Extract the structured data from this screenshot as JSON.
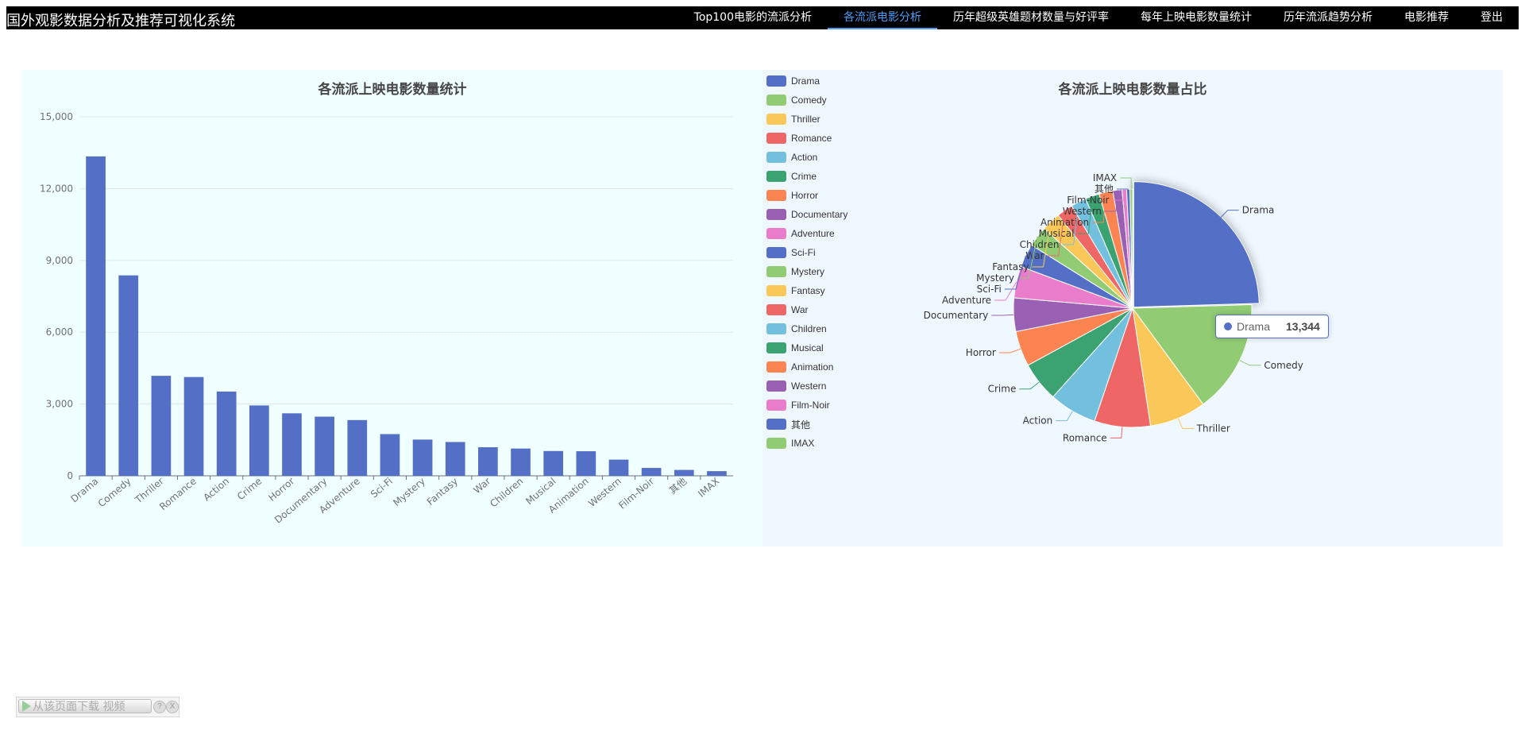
{
  "app": {
    "title": "国外观影数据分析及推荐可视化系统",
    "nav": [
      {
        "label": "Top100电影的流派分析",
        "active": false
      },
      {
        "label": "各流派电影分析",
        "active": true
      },
      {
        "label": "历年超级英雄题材数量与好评率",
        "active": false
      },
      {
        "label": "每年上映电影数量统计",
        "active": false
      },
      {
        "label": "历年流派趋势分析",
        "active": false
      },
      {
        "label": "电影推荐",
        "active": false
      },
      {
        "label": "登出",
        "active": false
      }
    ]
  },
  "chart_data": [
    {
      "type": "bar",
      "title": "各流派上映电影数量统计",
      "categories": [
        "Drama",
        "Comedy",
        "Thriller",
        "Romance",
        "Action",
        "Crime",
        "Horror",
        "Documentary",
        "Adventure",
        "Sci-Fi",
        "Mystery",
        "Fantasy",
        "War",
        "Children",
        "Musical",
        "Animation",
        "Western",
        "Film-Noir",
        "其他",
        "IMAX"
      ],
      "values": [
        13344,
        8374,
        4178,
        4127,
        3520,
        2939,
        2611,
        2471,
        2329,
        1743,
        1514,
        1412,
        1194,
        1139,
        1036,
        1027,
        676,
        330,
        246,
        196
      ],
      "yticks": [
        "0",
        "3,000",
        "6,000",
        "9,000",
        "12,000",
        "15,000"
      ],
      "ylim": [
        0,
        15000
      ],
      "color": "#5470c6",
      "grid": true
    },
    {
      "type": "pie",
      "title": "各流派上映电影数量占比",
      "categories": [
        "Drama",
        "Comedy",
        "Thriller",
        "Romance",
        "Action",
        "Crime",
        "Horror",
        "Documentary",
        "Adventure",
        "Sci-Fi",
        "Mystery",
        "Fantasy",
        "War",
        "Children",
        "Musical",
        "Animation",
        "Western",
        "Film-Noir",
        "其他",
        "IMAX"
      ],
      "values": [
        13344,
        8374,
        4178,
        4127,
        3520,
        2939,
        2611,
        2471,
        2329,
        1743,
        1514,
        1412,
        1194,
        1139,
        1036,
        1027,
        676,
        330,
        246,
        196
      ],
      "colors": [
        "#5470c6",
        "#91cc75",
        "#fac858",
        "#ee6666",
        "#73c0de",
        "#3ba272",
        "#fc8452",
        "#9a60b4",
        "#ea7ccc",
        "#5470c6",
        "#91cc75",
        "#fac858",
        "#ee6666",
        "#73c0de",
        "#3ba272",
        "#fc8452",
        "#9a60b4",
        "#ea7ccc",
        "#5470c6",
        "#91cc75"
      ],
      "legend_position": "top-left",
      "highlighted": "Drama"
    }
  ],
  "tooltip": {
    "name": "Drama",
    "value": "13,344"
  },
  "download_bar": {
    "label": "从该页面下载 视频",
    "help": "?",
    "close": "X",
    "play_icon": "play-icon"
  }
}
